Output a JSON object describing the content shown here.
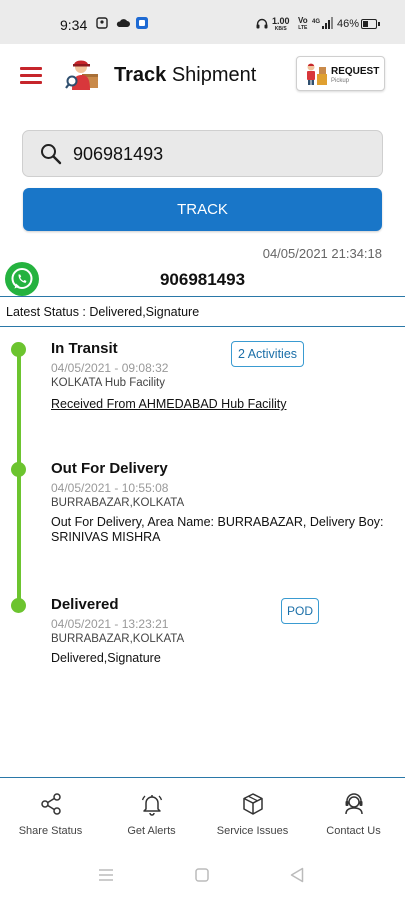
{
  "status_bar": {
    "time": "9:34",
    "net_speed_value": "1.00",
    "net_speed_unit": "KB/S",
    "volte_top": "Vo",
    "volte_bottom": "LTE",
    "signal_label": "4G",
    "battery_percent": "46%",
    "battery_level": 0.46,
    "icons": [
      "notification-icon",
      "cloud-icon",
      "app-icon",
      "headset-icon",
      "signal-icon",
      "battery-icon"
    ]
  },
  "header": {
    "title_bold": "Track",
    "title_rest": " Shipment",
    "request_title": "REQUEST",
    "request_subtitle": "Pickup",
    "accent": "#c6252b"
  },
  "search": {
    "value": "906981493",
    "placeholder": ""
  },
  "track_button_label": "TRACK",
  "result": {
    "timestamp": "04/05/2021 21:34:18",
    "awb": "906981493",
    "latest_status_label": "Latest Status : ",
    "latest_status_value": "Delivered,Signature"
  },
  "events": [
    {
      "title": "In Transit",
      "datetime": "04/05/2021 - 09:08:32",
      "location": "KOLKATA Hub Facility",
      "description": "Received From AHMEDABAD Hub Facility",
      "button": "2 Activities"
    },
    {
      "title": "Out For Delivery",
      "datetime": "04/05/2021 - 10:55:08",
      "location": "BURRABAZAR,KOLKATA",
      "description": "Out For Delivery, Area Name: BURRABAZAR, Delivery Boy: SRINIVAS MISHRA"
    },
    {
      "title": "Delivered",
      "datetime": "04/05/2021 - 13:23:21",
      "location": "BURRABAZAR,KOLKATA",
      "description": "Delivered,Signature",
      "button": "POD"
    }
  ],
  "bottom_nav": [
    {
      "label": "Share Status",
      "icon": "share-icon"
    },
    {
      "label": "Get Alerts",
      "icon": "bell-icon"
    },
    {
      "label": "Service Issues",
      "icon": "package-icon"
    },
    {
      "label": "Contact Us",
      "icon": "support-agent-icon"
    }
  ],
  "colors": {
    "primary_blue": "#1976c8",
    "timeline_green": "#6cc42f",
    "whatsapp_green": "#25b23f",
    "divider_blue": "#2a78a8"
  }
}
